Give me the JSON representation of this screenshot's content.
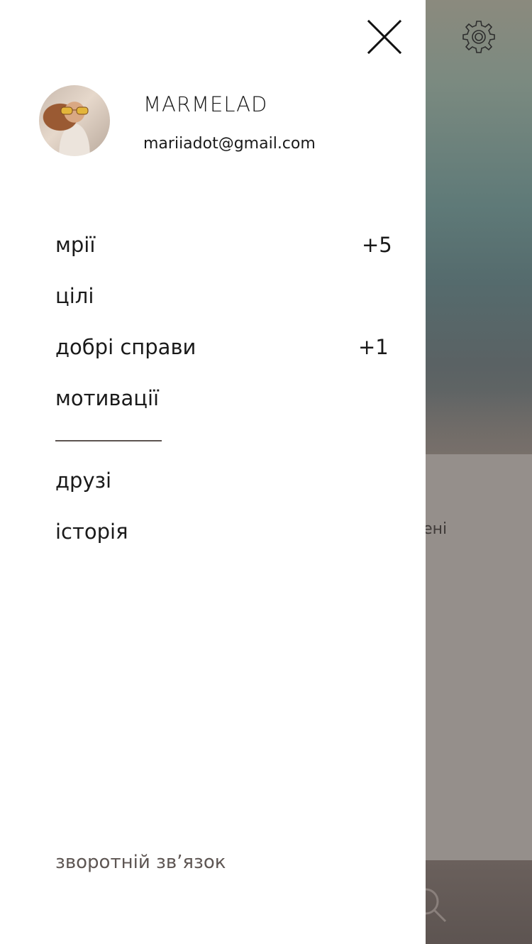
{
  "background": {
    "panel_text": "шені",
    "icons": {
      "settings": "gear-icon",
      "search": "search-icon"
    }
  },
  "drawer": {
    "close_icon": "close-icon",
    "user": {
      "name": "MARMELAD",
      "email": "mariiadot@gmail.com"
    },
    "menu": [
      {
        "label": "мрії",
        "count": "+5"
      },
      {
        "label": "цілі",
        "count": ""
      },
      {
        "label": "добрі справи",
        "count": "+1"
      },
      {
        "label": "мотивації",
        "count": ""
      }
    ],
    "secondary_menu": [
      {
        "label": "друзі"
      },
      {
        "label": "історія"
      }
    ],
    "feedback": "зворотній зв’язок"
  },
  "colors": {
    "drawer_bg": "#ffffff",
    "text": "#1a1a1a",
    "muted_text": "#5e5653",
    "divider": "#5d5350",
    "overlay_panel": "#958f8b"
  }
}
